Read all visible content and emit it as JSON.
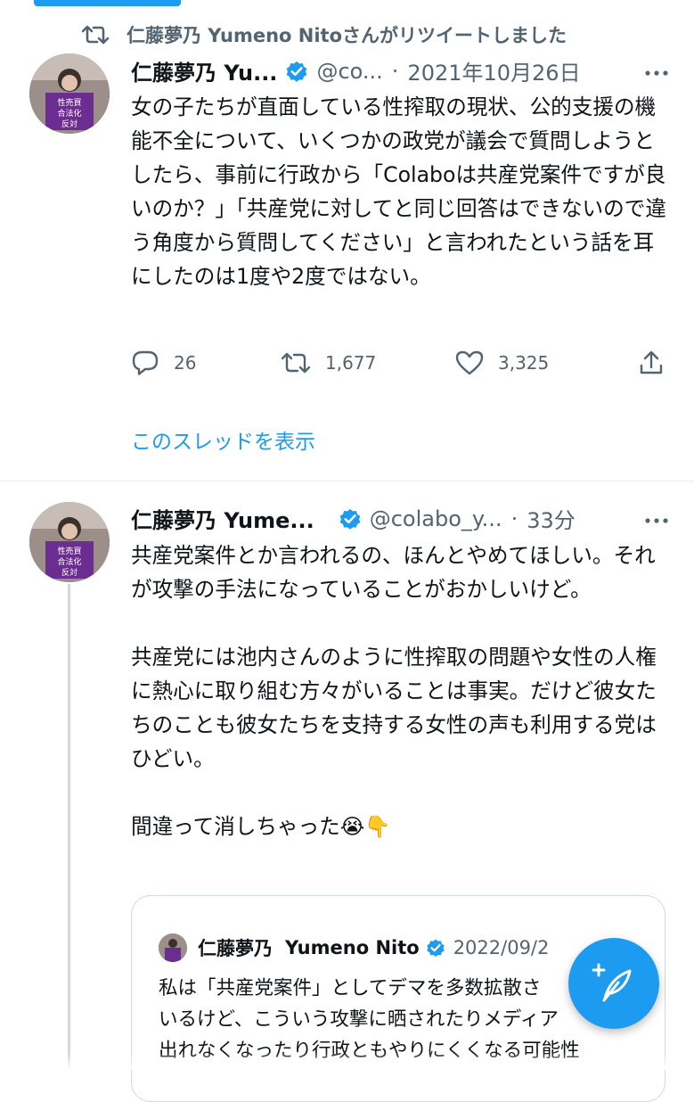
{
  "retweet_banner": {
    "text": "仁藤夢乃 Yumeno Nitoさんがリツイートしました",
    "icon": "retweet-icon"
  },
  "tweet1": {
    "name": "仁藤夢乃 Yu...",
    "handle": "@co...",
    "dot": "·",
    "time": "2021年10月26日",
    "text": "女の子たちが直面している性搾取の現状、公的支援の機能不全について、いくつかの政党が議会で質問しようとしたら、事前に行政から「Colaboは共産党案件ですが良いのか？」「共産党に対してと同じ回答はできないので違う角度から質問してください」と言われたという話を耳にしたのは1度や2度ではない。",
    "avatar_sign": {
      "line1": "性売買",
      "line2": "合法化",
      "line3": "反対"
    },
    "actions": {
      "reply_count": "26",
      "retweet_count": "1,677",
      "like_count": "3,325"
    },
    "show_thread": "このスレッドを表示"
  },
  "tweet2": {
    "name": "仁藤夢乃 Yume...",
    "handle": "@colabo_y...",
    "dot": "·",
    "time": "33分",
    "text": "共産党案件とか言われるの、ほんとやめてほしい。それが攻撃の手法になっていることがおかしいけど。\n\n共産党には池内さんのように性搾取の問題や女性の人権に熱心に取り組む方々がいることは事実。だけど彼女たちのことも彼女たちを支持する女性の声も利用する党はひどい。\n\n間違って消しちゃった😭👇",
    "avatar_sign": {
      "line1": "性売買",
      "line2": "合法化",
      "line3": "反対"
    }
  },
  "quote": {
    "name": "仁藤夢乃",
    "name_en": "Yumeno Nito",
    "time": "2022/09/2",
    "text": "私は「共産党案件」としてデマを多数拡散さ\nいるけど、こういう攻撃に晒されたりメディア\n出れなくなったり行政ともやりにくくなる可能性"
  },
  "colors": {
    "accent": "#1d9bf0",
    "muted": "#536471",
    "text": "#0f1419",
    "sign_purple": "#6b2d8f"
  },
  "fab": {
    "icon": "compose-feather-icon"
  }
}
